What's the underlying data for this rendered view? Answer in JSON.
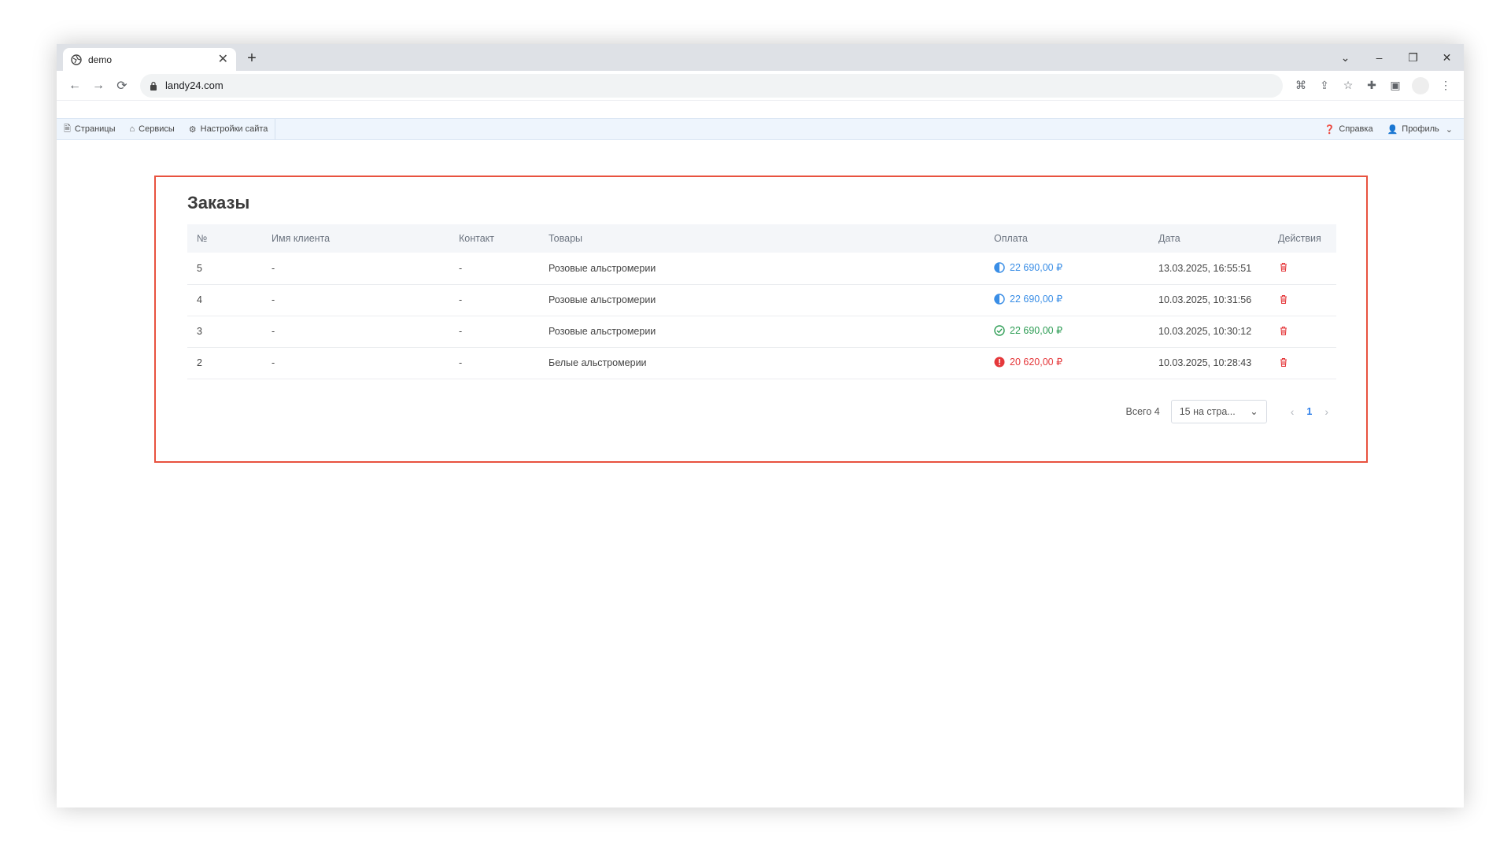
{
  "browser": {
    "tab_title": "demo",
    "tab_close": "✕",
    "new_tab": "+",
    "url": "landy24.com",
    "window_controls": [
      "⌄",
      "–",
      "❐",
      "✕"
    ]
  },
  "adminbar": {
    "left": [
      {
        "icon": "document-icon",
        "label": "Страницы"
      },
      {
        "icon": "toolbox-icon",
        "label": "Сервисы"
      },
      {
        "icon": "gear-icon",
        "label": "Настройки сайта"
      }
    ],
    "help": "Справка",
    "profile": "Профиль"
  },
  "orders": {
    "title": "Заказы",
    "columns": [
      "№",
      "Имя клиента",
      "Контакт",
      "Товары",
      "Оплата",
      "Дата",
      "Действия"
    ],
    "rows": [
      {
        "num": "5",
        "client": "-",
        "contact": "-",
        "goods": "Розовые альстромерии",
        "payment": "22 690,00 ₽",
        "status": "partial",
        "date": "13.03.2025, 16:55:51"
      },
      {
        "num": "4",
        "client": "-",
        "contact": "-",
        "goods": "Розовые альстромерии",
        "payment": "22 690,00 ₽",
        "status": "partial",
        "date": "10.03.2025, 10:31:56"
      },
      {
        "num": "3",
        "client": "-",
        "contact": "-",
        "goods": "Розовые альстромерии",
        "payment": "22 690,00 ₽",
        "status": "paid",
        "date": "10.03.2025, 10:30:12"
      },
      {
        "num": "2",
        "client": "-",
        "contact": "-",
        "goods": "Белые альстромерии",
        "payment": "20 620,00 ₽",
        "status": "error",
        "date": "10.03.2025, 10:28:43"
      }
    ],
    "pagination": {
      "total": "Всего 4",
      "page_size": "15 на стра...",
      "current_page": "1"
    }
  },
  "colors": {
    "frame": "#e8523f",
    "partial": "#3a8ee6",
    "paid": "#2e9d55",
    "error": "#e5383b"
  }
}
